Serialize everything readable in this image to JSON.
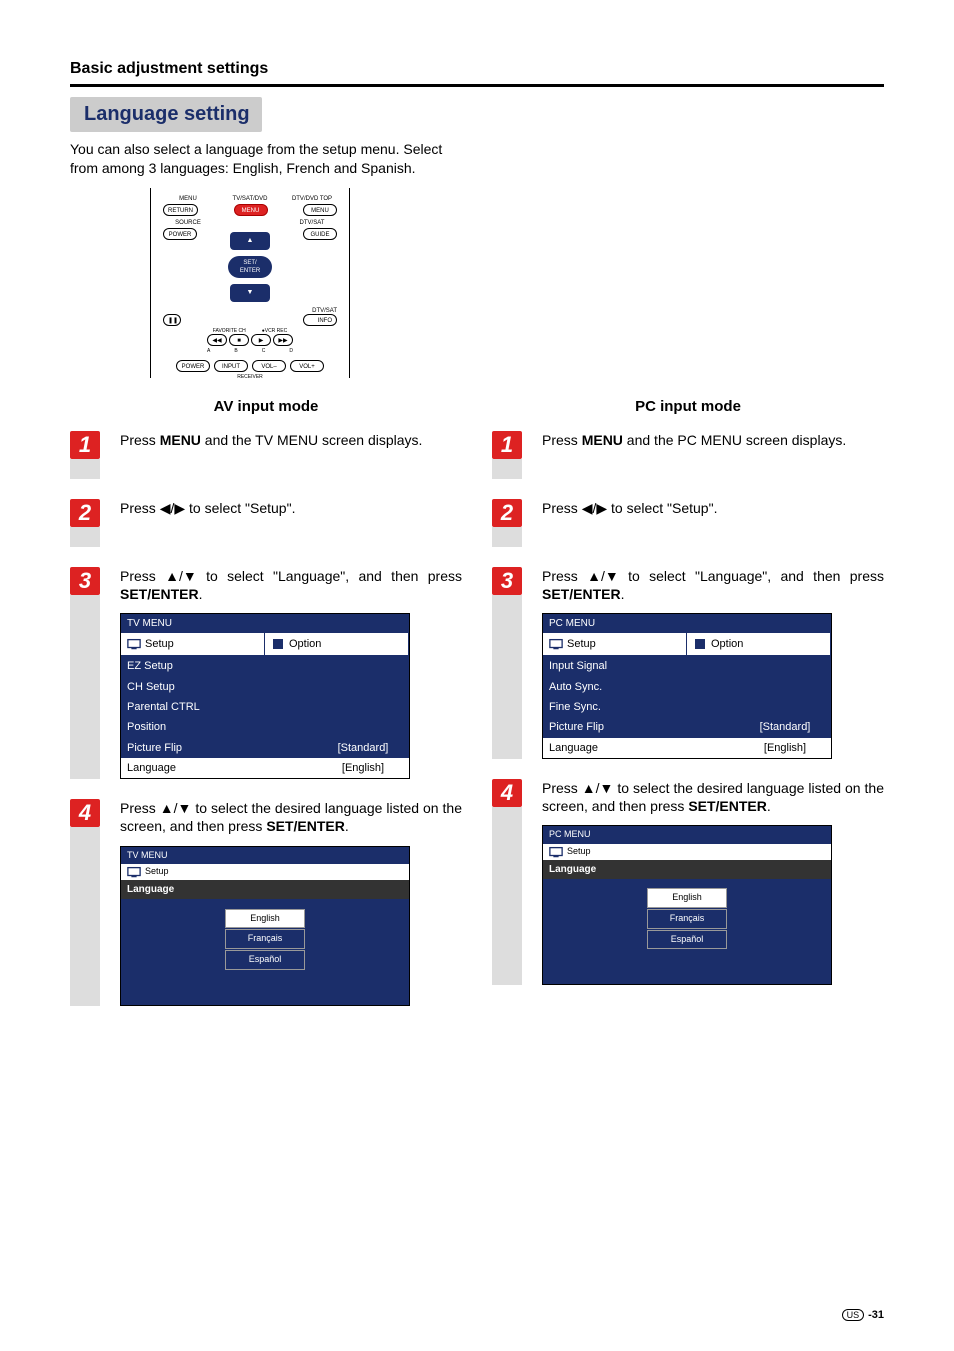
{
  "header": {
    "section": "Basic adjustment settings",
    "heading": "Language setting",
    "intro": "You can also select a language from the setup menu. Select from among 3 languages: English, French and Spanish."
  },
  "remote": {
    "row1": {
      "l1": "MENU",
      "l2": "TV/SAT/DVD",
      "l3": "DTV/DVD TOP"
    },
    "row1b": {
      "b1": "RETURN",
      "b2": "MENU",
      "b3": "MENU"
    },
    "row2l": "SOURCE",
    "row2r": "DTV/SAT",
    "row2bl": "POWER",
    "row2br": "GUIDE",
    "center1": "SET/",
    "center2": "ENTER",
    "row3r": "DTV/SAT",
    "row3br": "INFO",
    "fav": "FAVORITE CH",
    "vcr": "VCR REC",
    "abcd": [
      "A",
      "B",
      "C",
      "D"
    ],
    "bottom": {
      "b1": "POWER",
      "b2": "INPUT",
      "b3": "VOL–",
      "b4": "VOL+",
      "label": "RECEIVER"
    }
  },
  "av": {
    "title": "AV input mode",
    "steps": [
      {
        "n": "1",
        "prefix": "Press ",
        "bold": "MENU",
        "suffix": " and the TV MENU screen displays."
      },
      {
        "n": "2",
        "prefix": "Press ",
        "icons": "lr",
        "suffix": " to select \"Setup\"."
      },
      {
        "n": "3",
        "prefix": "Press ",
        "icons": "ud",
        "mid": " to select \"Language\", and then press ",
        "bold2": "SET/ENTER",
        "suffix2": "."
      },
      {
        "n": "4",
        "prefix": "Press ",
        "icons": "ud",
        "mid": " to select the desired language listed on the screen, and then press ",
        "bold2": "SET/ENTER",
        "suffix2": "."
      }
    ],
    "menu": {
      "title": "TV MENU",
      "tabs": [
        "Setup",
        "Option"
      ],
      "rows": [
        {
          "label": "EZ Setup",
          "val": ""
        },
        {
          "label": "CH Setup",
          "val": ""
        },
        {
          "label": "Parental CTRL",
          "val": ""
        },
        {
          "label": "Position",
          "val": ""
        },
        {
          "label": "Picture Flip",
          "val": "[Standard]"
        },
        {
          "label": "Language",
          "val": "[English]",
          "sel": true
        }
      ]
    },
    "langmenu": {
      "title": "TV MENU",
      "tab": "Setup",
      "sub": "Language",
      "opts": [
        "English",
        "Français",
        "Español"
      ]
    }
  },
  "pc": {
    "title": "PC input mode",
    "steps": [
      {
        "n": "1",
        "prefix": "Press ",
        "bold": "MENU",
        "suffix": " and the PC MENU screen displays."
      },
      {
        "n": "2",
        "prefix": "Press ",
        "icons": "lr",
        "suffix": " to select \"Setup\"."
      },
      {
        "n": "3",
        "prefix": "Press ",
        "icons": "ud",
        "mid": " to select \"Language\", and then press ",
        "bold2": "SET/ENTER",
        "suffix2": "."
      },
      {
        "n": "4",
        "prefix": "Press ",
        "icons": "ud",
        "mid": " to select the desired language listed on the screen, and then press ",
        "bold2": "SET/ENTER",
        "suffix2": "."
      }
    ],
    "menu": {
      "title": "PC MENU",
      "tabs": [
        "Setup",
        "Option"
      ],
      "rows": [
        {
          "label": "Input Signal",
          "val": ""
        },
        {
          "label": "Auto Sync.",
          "val": ""
        },
        {
          "label": "Fine Sync.",
          "val": ""
        },
        {
          "label": "Picture Flip",
          "val": "[Standard]"
        },
        {
          "label": "Language",
          "val": "[English]",
          "sel": true
        }
      ]
    },
    "langmenu": {
      "title": "PC MENU",
      "tab": "Setup",
      "sub": "Language",
      "opts": [
        "English",
        "Français",
        "Español"
      ]
    }
  },
  "footer": {
    "region": "US",
    "page": "-31"
  }
}
